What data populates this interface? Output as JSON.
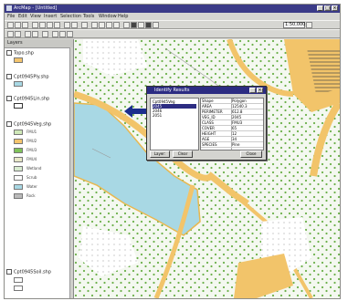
{
  "window": {
    "title": "ArcMap - [Untitled]",
    "minimize": "_",
    "maximize": "□",
    "close": "×"
  },
  "menu": [
    "File",
    "Edit",
    "View",
    "Insert",
    "Selection",
    "Tools",
    "Window",
    "Help"
  ],
  "toolbar": {
    "scale": "1:50,000"
  },
  "toc": {
    "header": "Layers",
    "layers": [
      {
        "label": "Topo.shp",
        "checked": true
      },
      {
        "label": "Cpt0945Ply.shp",
        "checked": true
      },
      {
        "label": "Cpt0945Lin.shp",
        "checked": true
      },
      {
        "label": "Cpt0945Veg.shp",
        "checked": true
      },
      {
        "label": "Cpt0945Soil.shp",
        "checked": true
      }
    ],
    "legend_items": [
      "FMU1",
      "FMU2",
      "FMU3",
      "FMU4",
      "Wetland",
      "Scrub",
      "Water",
      "Rock"
    ]
  },
  "dialog": {
    "title": "Identify Results",
    "list": [
      "Cpt0945Veg",
      "  2045",
      "  2046",
      "  2051"
    ],
    "fields": [
      {
        "f": "Shape",
        "v": "Polygon"
      },
      {
        "f": "AREA",
        "v": "12540.3"
      },
      {
        "f": "PERIMETER",
        "v": "612.8"
      },
      {
        "f": "VEG_ID",
        "v": "2045"
      },
      {
        "f": "CLASS",
        "v": "FMU3"
      },
      {
        "f": "COVER",
        "v": "65"
      },
      {
        "f": "HEIGHT",
        "v": "12"
      },
      {
        "f": "AGE",
        "v": "34"
      },
      {
        "f": "SPECIES",
        "v": "Pine"
      },
      {
        "f": "STATUS",
        "v": "Active"
      }
    ],
    "buttons": [
      "Layer:",
      "Clear",
      "Close"
    ]
  },
  "colors": {
    "water": "#a8d8e4",
    "road": "#f2c46a",
    "veg_dot": "#6bb04a",
    "title": "#3b3b88"
  }
}
